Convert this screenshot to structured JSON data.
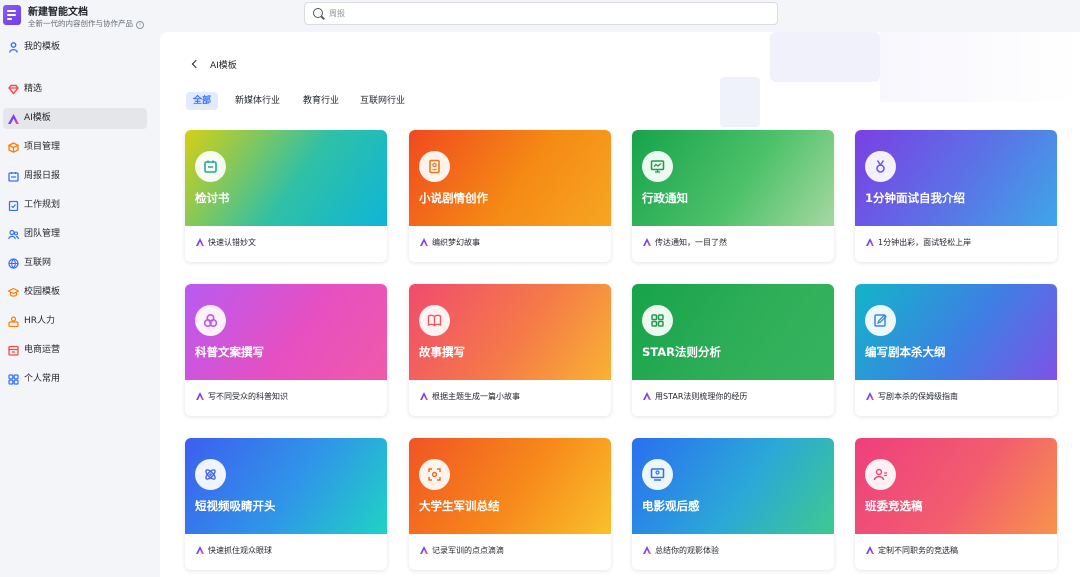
{
  "app": {
    "title": "新建智能文档",
    "subtitle": "全新一代的内容创作与协作产品"
  },
  "search": {
    "placeholder": "周报"
  },
  "sidebar": {
    "items": [
      {
        "label": "我的模板",
        "icon": "user-icon",
        "color": "#3370ff"
      },
      {
        "label": "精选",
        "icon": "diamond-icon",
        "color": "#f54a45"
      },
      {
        "label": "AI模板",
        "icon": "ai-icon",
        "color": "#7f3bf5",
        "active": true
      },
      {
        "label": "项目管理",
        "icon": "cube-icon",
        "color": "#ff7d00"
      },
      {
        "label": "周报日报",
        "icon": "calendar-icon",
        "color": "#3370ff"
      },
      {
        "label": "工作规划",
        "icon": "clipboard-icon",
        "color": "#3370ff"
      },
      {
        "label": "团队管理",
        "icon": "team-icon",
        "color": "#3370ff"
      },
      {
        "label": "互联网",
        "icon": "globe-icon",
        "color": "#3370ff"
      },
      {
        "label": "校园模板",
        "icon": "graduation-cap-icon",
        "color": "#ff7d00"
      },
      {
        "label": "HR人力",
        "icon": "person-badge-icon",
        "color": "#ff7d00"
      },
      {
        "label": "电商运营",
        "icon": "shop-icon",
        "color": "#f54a45"
      },
      {
        "label": "个人常用",
        "icon": "grid-icon",
        "color": "#3370ff"
      }
    ]
  },
  "main": {
    "title": "AI模板",
    "tabs": [
      {
        "label": "全部",
        "active": true
      },
      {
        "label": "新媒体行业"
      },
      {
        "label": "教育行业"
      },
      {
        "label": "互联网行业"
      }
    ],
    "cards": [
      {
        "title": "检讨书",
        "desc": "快速认错妙文",
        "icon": "calendar-icon",
        "gradient": [
          "#d6cf13",
          "#2fc0a6",
          "#0fb5d8"
        ]
      },
      {
        "title": "小说剧情创作",
        "desc": "编织梦幻故事",
        "icon": "book-icon",
        "gradient": [
          "#f0491f",
          "#f58a14",
          "#f6a623"
        ]
      },
      {
        "title": "行政通知",
        "desc": "传达通知，一目了然",
        "icon": "monitor-icon",
        "gradient": [
          "#16a34a",
          "#4cc16a",
          "#a7d8a0"
        ]
      },
      {
        "title": "1分钟面试自我介绍",
        "desc": "1分钟出彩，面试轻松上岸",
        "icon": "medal-icon",
        "gradient": [
          "#7b3fe4",
          "#5a74e6",
          "#3ea6e8"
        ]
      },
      {
        "title": "科普文案撰写",
        "desc": "写不同受众的科普知识",
        "icon": "flask-icon",
        "gradient": [
          "#b85bf2",
          "#e64fc1",
          "#f05aa8"
        ]
      },
      {
        "title": "故事撰写",
        "desc": "根据主题生成一篇小故事",
        "icon": "open-book-icon",
        "gradient": [
          "#f04b6e",
          "#f57a48",
          "#f9b233"
        ]
      },
      {
        "title": "STAR法则分析",
        "desc": "用STAR法则梳理你的经历",
        "icon": "grid-icon",
        "gradient": [
          "#16a34a",
          "#2fae58",
          "#37b35f"
        ]
      },
      {
        "title": "编写剧本杀大纲",
        "desc": "写剧本杀的保姆级指南",
        "icon": "edit-icon",
        "gradient": [
          "#12b5c9",
          "#3e7fe4",
          "#7e53e6"
        ]
      },
      {
        "title": "短视频吸睛开头",
        "desc": "快速抓住观众眼球",
        "icon": "atom-icon",
        "gradient": [
          "#3d5ef0",
          "#2f97e8",
          "#1fd3c4"
        ]
      },
      {
        "title": "大学生军训总结",
        "desc": "记录军训的点点滴滴",
        "icon": "target-icon",
        "gradient": [
          "#f05423",
          "#f78a1b",
          "#f9c12b"
        ]
      },
      {
        "title": "电影观后感",
        "desc": "总结你的观影体验",
        "icon": "screen-icon",
        "gradient": [
          "#2a6ff0",
          "#2ba8d8",
          "#3fc98f"
        ]
      },
      {
        "title": "班委竞选稿",
        "desc": "定制不同职务的竞选稿",
        "icon": "user-card-icon",
        "gradient": [
          "#ee3f7e",
          "#f25d6e",
          "#f8934b"
        ]
      }
    ]
  }
}
